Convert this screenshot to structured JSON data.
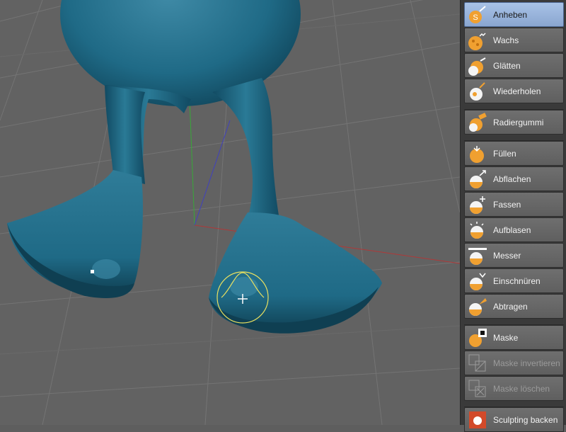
{
  "viewport": {
    "scene": "sculpted-duck-feet"
  },
  "colors": {
    "model": "#1f6a86",
    "model_dark": "#0f4a62",
    "model_light": "#3f8aa6",
    "grid_bg": "#626262",
    "grid_line": "#747474",
    "axis_x": "#b03030",
    "axis_y": "#30a030",
    "axis_z": "#3030b0",
    "brush": "#e8e060",
    "panel_bg": "#3a3a3a",
    "active_tool": "#9fb9e0"
  },
  "tools": {
    "group1": [
      {
        "label": "Anheben",
        "icon": "pull-brush-icon",
        "active": true
      },
      {
        "label": "Wachs",
        "icon": "wax-brush-icon"
      },
      {
        "label": "Glätten",
        "icon": "smooth-brush-icon"
      },
      {
        "label": "Wiederholen",
        "icon": "repeat-brush-icon"
      }
    ],
    "group2": [
      {
        "label": "Radiergummi",
        "icon": "eraser-brush-icon"
      }
    ],
    "group3": [
      {
        "label": "Füllen",
        "icon": "fill-brush-icon"
      },
      {
        "label": "Abflachen",
        "icon": "flatten-brush-icon"
      },
      {
        "label": "Fassen",
        "icon": "grab-brush-icon"
      },
      {
        "label": "Aufblasen",
        "icon": "inflate-brush-icon"
      },
      {
        "label": "Messer",
        "icon": "knife-brush-icon"
      },
      {
        "label": "Einschnüren",
        "icon": "pinch-brush-icon"
      },
      {
        "label": "Abtragen",
        "icon": "scrape-brush-icon"
      }
    ],
    "group4": [
      {
        "label": "Maske",
        "icon": "mask-brush-icon"
      },
      {
        "label": "Maske invertieren",
        "icon": "invert-mask-icon",
        "disabled": true
      },
      {
        "label": "Maske löschen",
        "icon": "clear-mask-icon",
        "disabled": true
      }
    ],
    "group5": [
      {
        "label": "Sculpting backen",
        "icon": "bake-sculpt-icon"
      }
    ]
  }
}
